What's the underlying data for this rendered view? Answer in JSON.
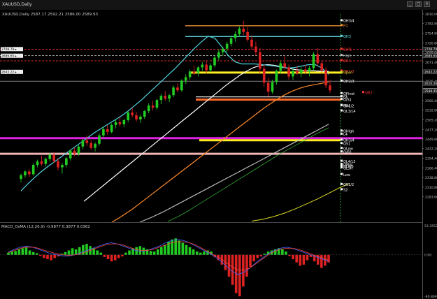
{
  "window": {
    "title": "XAUUSD,Daily",
    "close_icon": "×",
    "maximize_icon": "□",
    "minimize_icon": "_"
  },
  "main_header": {
    "symbol": "XAUUSD,Daily",
    "ohlc": "2587.17 2592.21 2586.00 2589.93"
  },
  "osc_header": {
    "label": "MACD_OsMA (12,26,9) -0.9877 0.3877 0.0362"
  },
  "colors": {
    "up": "#22cc22",
    "down": "#dd2222",
    "ma_fast": "#4fd3e0",
    "ma_mid": "#ffffff",
    "ma_slow": "#ff8a2a",
    "ma_long": "#bbbbbb",
    "ma_trend": "#33aa33",
    "ma_yellow": "#dddd22",
    "pivot_label": "#ffffff",
    "magenta": "#e020e0",
    "pink": "#f2b4b4",
    "yellow": "#ffe020",
    "orange": "#ff6a2a",
    "osc_pos": "#22cc22",
    "osc_neg": "#dd2222",
    "osc_line_blue": "#4466ff",
    "osc_line_red": "#ff4444"
  },
  "chart_data": [
    {
      "type": "line",
      "title": "XAUUSD,Daily",
      "ylim": [
        2210,
        2810
      ],
      "y_ticks": [
        "2810.00",
        "2782.80",
        "2754.90",
        "2726.80",
        "2699.60",
        "2671.40",
        "2643.80",
        "2616.40",
        "2588.40",
        "2560.40",
        "2532.80",
        "2505.20",
        "2477.20",
        "2449.80",
        "2422.20",
        "2394.40",
        "2366.40",
        "2338.80",
        "2310.80",
        "2283.60"
      ],
      "current_price": "2589.93",
      "price_tags": [
        "2708.79",
        "2689.65",
        "2643.22",
        "2610.26",
        "2588.45"
      ],
      "left_tags": [
        "2708.79 ▸",
        "2689.65 ▸",
        "2643.22 ▸"
      ],
      "candles": [
        [
          2335,
          2350,
          2325,
          2345
        ],
        [
          2345,
          2360,
          2338,
          2356
        ],
        [
          2356,
          2362,
          2340,
          2348
        ],
        [
          2348,
          2380,
          2344,
          2375
        ],
        [
          2375,
          2390,
          2368,
          2385
        ],
        [
          2385,
          2402,
          2372,
          2378
        ],
        [
          2378,
          2396,
          2370,
          2392
        ],
        [
          2392,
          2410,
          2385,
          2404
        ],
        [
          2404,
          2412,
          2380,
          2386
        ],
        [
          2386,
          2395,
          2360,
          2368
        ],
        [
          2368,
          2380,
          2350,
          2375
        ],
        [
          2375,
          2398,
          2368,
          2394
        ],
        [
          2394,
          2420,
          2388,
          2416
        ],
        [
          2416,
          2425,
          2400,
          2408
        ],
        [
          2408,
          2432,
          2402,
          2428
        ],
        [
          2428,
          2450,
          2420,
          2446
        ],
        [
          2446,
          2460,
          2430,
          2438
        ],
        [
          2438,
          2446,
          2418,
          2424
        ],
        [
          2424,
          2440,
          2414,
          2436
        ],
        [
          2436,
          2465,
          2430,
          2460
        ],
        [
          2460,
          2484,
          2452,
          2478
        ],
        [
          2478,
          2490,
          2462,
          2470
        ],
        [
          2470,
          2495,
          2466,
          2490
        ],
        [
          2490,
          2506,
          2480,
          2498
        ],
        [
          2498,
          2512,
          2486,
          2492
        ],
        [
          2492,
          2508,
          2484,
          2504
        ],
        [
          2504,
          2530,
          2498,
          2526
        ],
        [
          2526,
          2540,
          2512,
          2518
        ],
        [
          2518,
          2528,
          2500,
          2506
        ],
        [
          2506,
          2520,
          2496,
          2514
        ],
        [
          2514,
          2534,
          2508,
          2530
        ],
        [
          2530,
          2552,
          2524,
          2546
        ],
        [
          2546,
          2560,
          2532,
          2540
        ],
        [
          2540,
          2566,
          2534,
          2562
        ],
        [
          2562,
          2580,
          2550,
          2574
        ],
        [
          2574,
          2588,
          2560,
          2566
        ],
        [
          2566,
          2580,
          2556,
          2576
        ],
        [
          2576,
          2604,
          2570,
          2598
        ],
        [
          2598,
          2610,
          2584,
          2590
        ],
        [
          2590,
          2622,
          2586,
          2618
        ],
        [
          2618,
          2636,
          2608,
          2628
        ],
        [
          2628,
          2650,
          2620,
          2644
        ],
        [
          2644,
          2662,
          2634,
          2640
        ],
        [
          2640,
          2660,
          2630,
          2656
        ],
        [
          2656,
          2672,
          2646,
          2664
        ],
        [
          2664,
          2676,
          2640,
          2648
        ],
        [
          2648,
          2668,
          2642,
          2662
        ],
        [
          2662,
          2690,
          2656,
          2684
        ],
        [
          2684,
          2708,
          2676,
          2700
        ],
        [
          2700,
          2716,
          2690,
          2710
        ],
        [
          2710,
          2730,
          2700,
          2724
        ],
        [
          2724,
          2748,
          2716,
          2740
        ],
        [
          2740,
          2760,
          2730,
          2752
        ],
        [
          2752,
          2774,
          2744,
          2768
        ],
        [
          2768,
          2790,
          2750,
          2758
        ],
        [
          2758,
          2772,
          2730,
          2736
        ],
        [
          2736,
          2748,
          2708,
          2716
        ],
        [
          2716,
          2730,
          2690,
          2700
        ],
        [
          2700,
          2712,
          2640,
          2652
        ],
        [
          2652,
          2664,
          2600,
          2612
        ],
        [
          2612,
          2626,
          2572,
          2586
        ],
        [
          2586,
          2620,
          2580,
          2614
        ],
        [
          2614,
          2650,
          2606,
          2646
        ],
        [
          2646,
          2676,
          2638,
          2668
        ],
        [
          2668,
          2690,
          2650,
          2656
        ],
        [
          2656,
          2664,
          2620,
          2630
        ],
        [
          2630,
          2652,
          2620,
          2646
        ],
        [
          2646,
          2660,
          2634,
          2640
        ],
        [
          2640,
          2656,
          2628,
          2650
        ],
        [
          2650,
          2664,
          2636,
          2644
        ],
        [
          2644,
          2660,
          2630,
          2654
        ],
        [
          2654,
          2700,
          2646,
          2694
        ],
        [
          2694,
          2712,
          2660,
          2668
        ],
        [
          2668,
          2676,
          2640,
          2648
        ],
        [
          2648,
          2656,
          2596,
          2604
        ],
        [
          2604,
          2620,
          2582,
          2590
        ]
      ],
      "ma_fast": [
        2300,
        2320,
        2338,
        2355,
        2370,
        2384,
        2398,
        2412,
        2426,
        2440,
        2454,
        2468,
        2480,
        2492,
        2504,
        2516,
        2530,
        2546,
        2562,
        2580,
        2598,
        2616,
        2634,
        2652,
        2672,
        2692,
        2712,
        2730,
        2746,
        2740,
        2716,
        2690,
        2672,
        2666,
        2666,
        2666,
        2664,
        2662,
        2660,
        2656,
        2654,
        2656,
        2660,
        2664,
        2664,
        2654,
        2636
      ],
      "ma_mid": [
        2270,
        2286,
        2302,
        2318,
        2334,
        2350,
        2366,
        2382,
        2398,
        2414,
        2430,
        2446,
        2462,
        2478,
        2494,
        2510,
        2526,
        2542,
        2558,
        2574,
        2590,
        2606,
        2620,
        2634,
        2646,
        2656,
        2662,
        2664,
        2662,
        2658,
        2654,
        2650,
        2648,
        2647,
        2646,
        2645,
        2644
      ],
      "ma_slow": [
        2210,
        2222,
        2236,
        2250,
        2266,
        2282,
        2298,
        2314,
        2330,
        2346,
        2362,
        2378,
        2394,
        2410,
        2426,
        2442,
        2458,
        2474,
        2490,
        2506,
        2522,
        2538,
        2552,
        2566,
        2578,
        2588,
        2596,
        2602,
        2606,
        2610,
        2614
      ],
      "ma_long": [
        2210,
        2224,
        2240,
        2258,
        2276,
        2294,
        2312,
        2330,
        2348,
        2366,
        2384,
        2402,
        2420,
        2438,
        2456,
        2474,
        2492
      ],
      "ma_trend": [
        2212,
        2226,
        2242,
        2260,
        2278,
        2296,
        2314,
        2332,
        2350,
        2368,
        2386,
        2404,
        2420,
        2436,
        2452,
        2468,
        2482
      ],
      "ma_yellow": [
        2213,
        2218,
        2226,
        2236,
        2248,
        2262,
        2276,
        2292,
        2308,
        2322
      ],
      "levels": [
        {
          "label": "QH3/4",
          "price": 2790,
          "color": "#ffffff"
        },
        {
          "label": "R1",
          "price": 2776,
          "color": "#ff9a3a"
        },
        {
          "label": "QH3",
          "price": 2745,
          "color": "#66e8f0"
        },
        {
          "label": "Q/R1",
          "price": 2708,
          "color": "#ff3333"
        },
        {
          "label": "High",
          "price": 2690,
          "color": "#bbbbbb"
        },
        {
          "label": "QR1",
          "price": 2675,
          "color": "#ff3333"
        },
        {
          "label": "QR2/3",
          "price": 2645,
          "color": "#ff3333"
        },
        {
          "label": "Open",
          "price": 2641,
          "color": "#dddd22"
        },
        {
          "label": "QH2/3",
          "price": 2616,
          "color": "#ffffff"
        },
        {
          "label": "QPivot",
          "price": 2580,
          "color": "#ffffff"
        },
        {
          "label": "QR2",
          "price": 2583,
          "color": "#ff3333"
        },
        {
          "label": "S1",
          "price": 2571,
          "color": "#ffffff"
        },
        {
          "label": "L3",
          "price": 2571,
          "color": "#ffffff"
        },
        {
          "label": "Q/S1",
          "price": 2563,
          "color": "#ffffff"
        },
        {
          "label": "Mid",
          "price": 2546,
          "color": "#ffffff"
        },
        {
          "label": "QR1/2",
          "price": 2545,
          "color": "#ffffff"
        },
        {
          "label": "QL3/L4",
          "price": 2530,
          "color": "#ffffff"
        },
        {
          "label": "QHigh",
          "price": 2472,
          "color": "#ffffff"
        },
        {
          "label": "L4",
          "price": 2463,
          "color": "#ffffff"
        },
        {
          "label": "QH3/4",
          "price": 2446,
          "color": "#ffffff"
        },
        {
          "label": "QS1",
          "price": 2436,
          "color": "#ffffff"
        },
        {
          "label": "QLow",
          "price": 2422,
          "color": "#ffffff"
        },
        {
          "label": "Q/R1",
          "price": 2412,
          "color": "#ffffff"
        },
        {
          "label": "QL4/L5",
          "price": 2385,
          "color": "#ffffff"
        },
        {
          "label": "QMid",
          "price": 2376,
          "color": "#ffffff"
        },
        {
          "label": "QL4/5",
          "price": 2371,
          "color": "#ffffff"
        },
        {
          "label": "QL5R",
          "price": 2366,
          "color": "#ffffff"
        },
        {
          "label": "Low",
          "price": 2347,
          "color": "#ffffff"
        },
        {
          "label": "QS1/2",
          "price": 2318,
          "color": "#ffffff"
        },
        {
          "label": "S2",
          "price": 2303,
          "color": "#ffffff"
        }
      ],
      "hlines": [
        {
          "price": 2776,
          "color": "#ff9a3a",
          "style": "solid",
          "from": "left-mid"
        },
        {
          "price": 2745,
          "color": "#66e8f0",
          "style": "solid",
          "from": "left-mid"
        },
        {
          "price": 2708,
          "color": "#ff3333",
          "style": "dash",
          "from": "all"
        },
        {
          "price": 2690,
          "color": "#aaaaaa",
          "style": "dash",
          "from": "all"
        },
        {
          "price": 2675,
          "color": "#ff3333",
          "style": "dash",
          "from": "all"
        },
        {
          "price": 2641,
          "color": "#ffee22",
          "style": "thick",
          "from": "mid"
        },
        {
          "price": 2616,
          "color": "#666666",
          "style": "solid",
          "from": "all"
        },
        {
          "price": 2571,
          "color": "#ffffff",
          "style": "solid",
          "from": "right"
        },
        {
          "price": 2563,
          "color": "#ff6a2a",
          "style": "thick",
          "from": "right"
        },
        {
          "price": 2452,
          "color": "#e020e0",
          "style": "thick",
          "from": "all"
        },
        {
          "price": 2446,
          "color": "#ffee22",
          "style": "thick",
          "from": "right-mid"
        },
        {
          "price": 2407,
          "color": "#f2b4b4",
          "style": "thick",
          "from": "all"
        }
      ]
    },
    {
      "type": "bar",
      "title": "MACD_OsMA (12,26,9) -0.9877 0.3877 0.0362",
      "ylim": [
        -80.8699,
        53.3552
      ],
      "y_ticks": [
        "53.3552",
        "0.00",
        "-80.8699"
      ],
      "values": [
        4,
        6,
        7,
        10,
        12,
        14,
        8,
        5,
        3,
        -2,
        -6,
        -8,
        -10,
        -6,
        -3,
        2,
        5,
        8,
        12,
        10,
        14,
        18,
        20,
        16,
        12,
        8,
        4,
        -4,
        -8,
        -12,
        -10,
        -6,
        -3,
        4,
        8,
        12,
        14,
        16,
        13,
        10,
        7,
        6,
        10,
        14,
        18,
        24,
        28,
        30,
        26,
        22,
        18,
        14,
        10,
        6,
        4,
        6,
        8,
        6,
        -4,
        -10,
        -18,
        -28,
        -40,
        -55,
        -70,
        -76,
        -58,
        -40,
        -22,
        -12,
        -6,
        -3,
        2,
        6,
        8,
        10,
        12,
        10,
        6,
        -2,
        -8,
        -14,
        -20,
        -18,
        -10,
        -4,
        -12,
        -18,
        -24,
        -20,
        -14
      ],
      "line_blue": [
        5,
        10,
        14,
        16,
        14,
        10,
        6,
        2,
        0,
        -2,
        -2,
        0,
        4,
        8,
        12,
        16,
        20,
        22,
        20,
        16,
        12,
        8,
        6,
        8,
        12,
        16,
        22,
        26,
        28,
        26,
        22,
        16,
        10,
        4,
        -2,
        -10,
        -20,
        -30,
        -36,
        -32,
        -24,
        -14,
        -6,
        2,
        8,
        12,
        14,
        12,
        8,
        4,
        0,
        -4,
        -8,
        -12
      ],
      "line_red": [
        4,
        8,
        12,
        14,
        14,
        12,
        8,
        5,
        2,
        0,
        -1,
        0,
        2,
        6,
        10,
        14,
        18,
        20,
        20,
        18,
        14,
        10,
        8,
        8,
        10,
        14,
        18,
        22,
        24,
        24,
        22,
        18,
        12,
        6,
        0,
        -6,
        -14,
        -22,
        -28,
        -28,
        -24,
        -16,
        -8,
        0,
        6,
        10,
        12,
        12,
        10,
        6,
        2,
        -2,
        -6,
        -10
      ]
    }
  ]
}
